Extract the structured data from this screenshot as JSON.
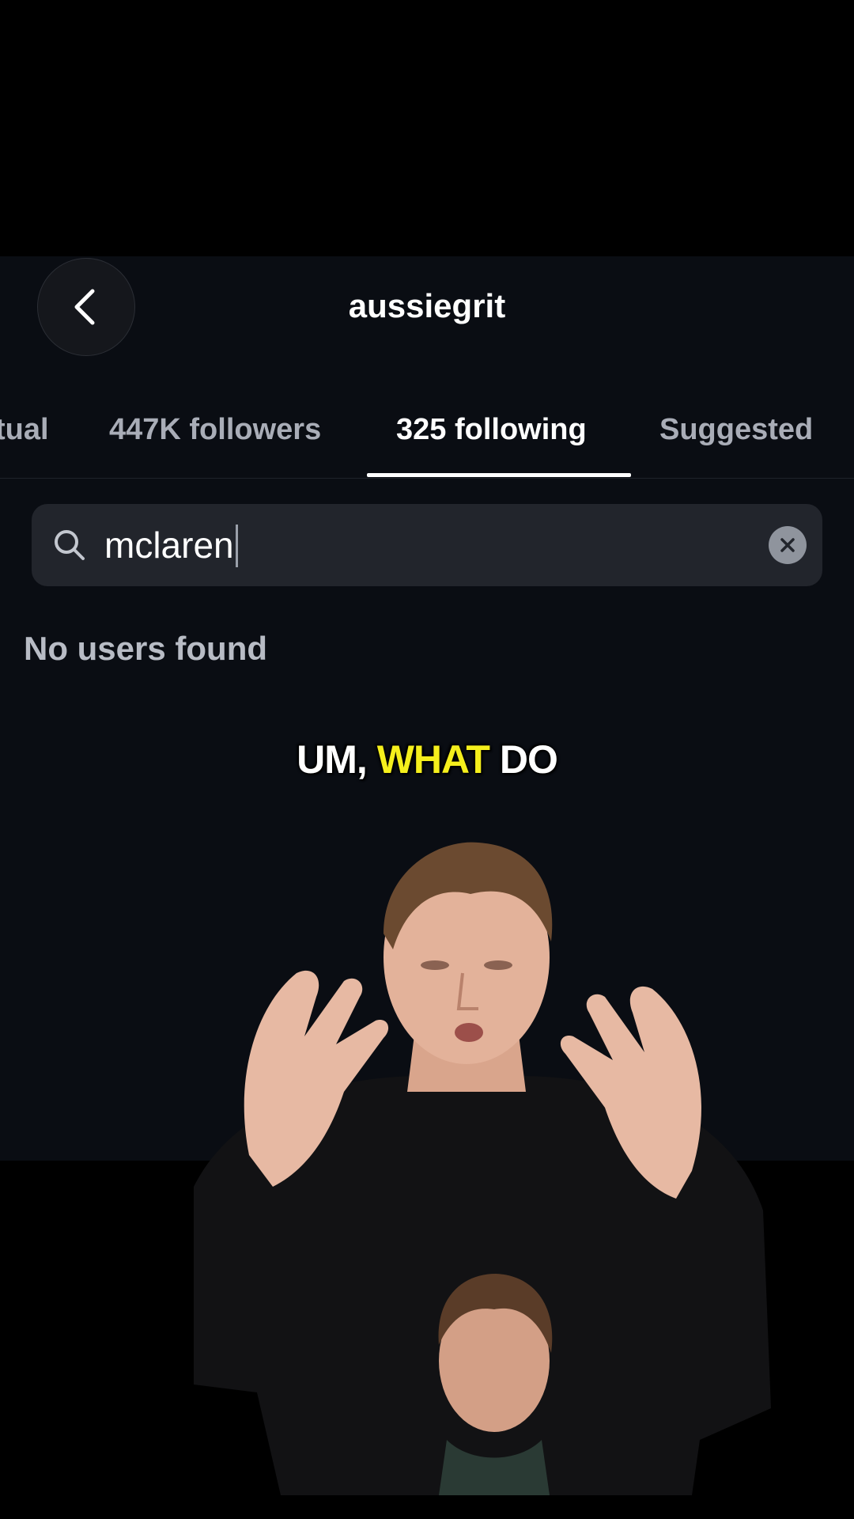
{
  "header": {
    "username": "aussiegrit",
    "back_label": "Back"
  },
  "tabs": [
    {
      "label": "tual",
      "active": false
    },
    {
      "label": "447K followers",
      "active": false
    },
    {
      "label": "325 following",
      "active": true
    },
    {
      "label": "Suggested",
      "active": false
    }
  ],
  "search": {
    "value": "mclaren",
    "icon": "search-icon",
    "clear_icon": "clear-icon"
  },
  "results": {
    "empty_message": "No users found"
  },
  "caption": {
    "word1": "UM,",
    "word2": "WHAT",
    "word3": "DO",
    "highlight_color": "#f5ef1c"
  },
  "colors": {
    "background": "#000000",
    "panel": "#0a0d13",
    "search_field": "#22252c",
    "active_tab": "#ffffff",
    "inactive_tab": "#a9adb7"
  }
}
